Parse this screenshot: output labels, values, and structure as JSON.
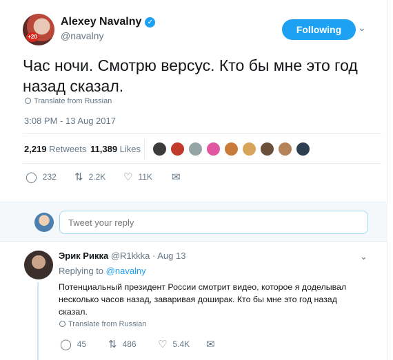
{
  "tweet": {
    "author_name": "Alexey Navalny",
    "author_handle": "@navalny",
    "avatar_badge": "+20",
    "follow_label": "Following",
    "text": "Час ночи. Смотрю версус. Кто бы мне это год назад сказал.",
    "translate_label": "Translate from Russian",
    "timestamp": "3:08 PM - 13 Aug 2017",
    "retweets_count": "2,219",
    "retweets_label": "Retweets",
    "likes_count": "11,389",
    "likes_label": "Likes",
    "reply_count": "232",
    "retweet_action_count": "2.2K",
    "like_action_count": "11K"
  },
  "likers": [
    {
      "color": "#3c3c3c"
    },
    {
      "color": "#c0392b"
    },
    {
      "color": "#95a5a6"
    },
    {
      "color": "#e056a0"
    },
    {
      "color": "#c97b3a"
    },
    {
      "color": "#d8a35a"
    },
    {
      "color": "#6b4f3a"
    },
    {
      "color": "#b5835a"
    },
    {
      "color": "#2c3e50"
    }
  ],
  "reply_box": {
    "placeholder": "Tweet your reply"
  },
  "reply_tweet": {
    "author_name": "Эрик Рикка",
    "author_handle": "@R1kkka",
    "date": "· Aug 13",
    "replying_prefix": "Replying to",
    "replying_to": "@navalny",
    "text": "Потенциальный президент России смотрит видео, которое я доделывал несколько часов назад, заваривая доширак. Кто бы мне это год назад сказал.",
    "translate_label": "Translate from Russian",
    "reply_count": "45",
    "retweet_count": "486",
    "like_count": "5.4K"
  },
  "colors": {
    "accent": "#1da1f2",
    "muted": "#657786",
    "text": "#14171a"
  }
}
